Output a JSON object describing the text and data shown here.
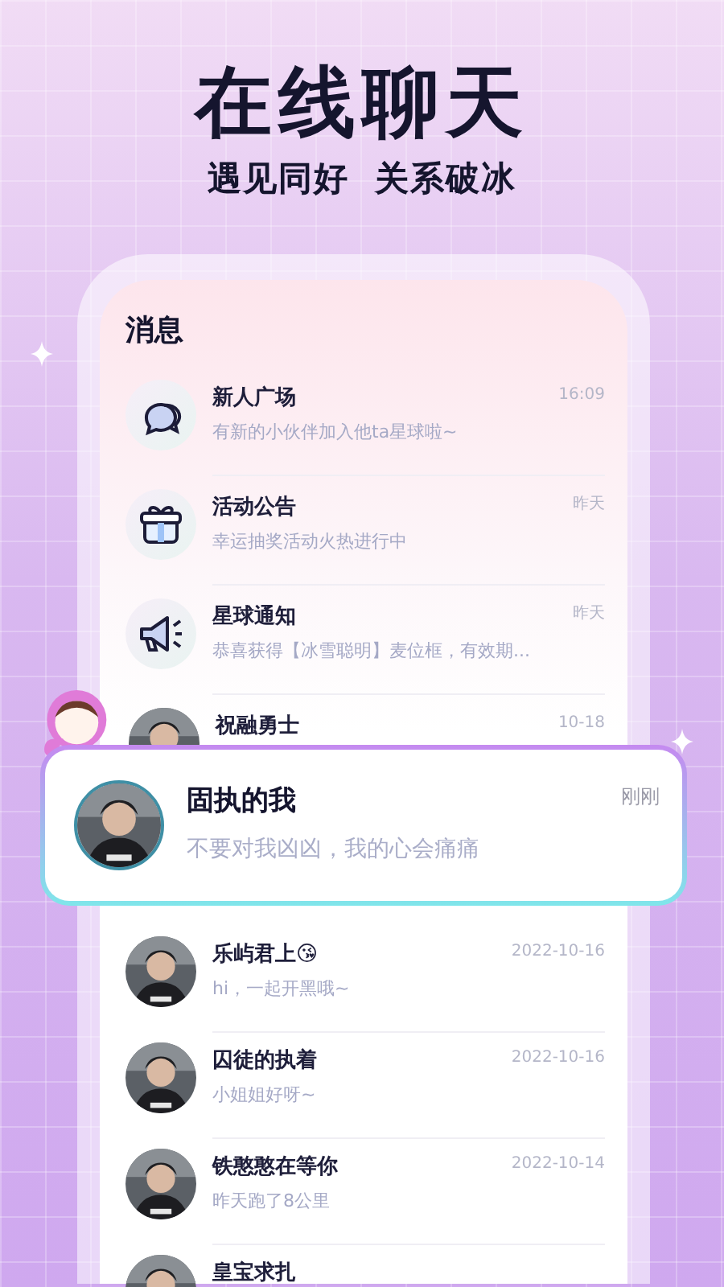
{
  "headline": "在线聊天",
  "taglines": [
    "遇见同好",
    "关系破冰"
  ],
  "screen_title": "消息",
  "messages": [
    {
      "kind": "chat",
      "name": "新人广场",
      "time": "16:09",
      "preview": "有新的小伙伴加入他ta星球啦~"
    },
    {
      "kind": "gift",
      "name": "活动公告",
      "time": "昨天",
      "preview": "幸运抽奖活动火热进行中"
    },
    {
      "kind": "megaphone",
      "name": "星球通知",
      "time": "昨天",
      "preview": "恭喜获得【冰雪聪明】麦位框，有效期..."
    },
    {
      "kind": "user",
      "name": "祝融勇士",
      "time": "10-18"
    }
  ],
  "featured": {
    "name": "固执的我",
    "time": "刚刚",
    "preview": "不要对我凶凶，我的心会痛痛"
  },
  "more_messages": [
    {
      "kind": "user",
      "name": "乐屿君上😘",
      "time": "2022-10-16",
      "preview": "hi，一起开黑哦~"
    },
    {
      "kind": "user",
      "name": "囚徒的执着",
      "time": "2022-10-16",
      "preview": "小姐姐好呀~"
    },
    {
      "kind": "user",
      "name": "铁憨憨在等你",
      "time": "2022-10-14",
      "preview": "昨天跑了8公里"
    },
    {
      "kind": "user",
      "name": "皇宝求扎"
    }
  ]
}
